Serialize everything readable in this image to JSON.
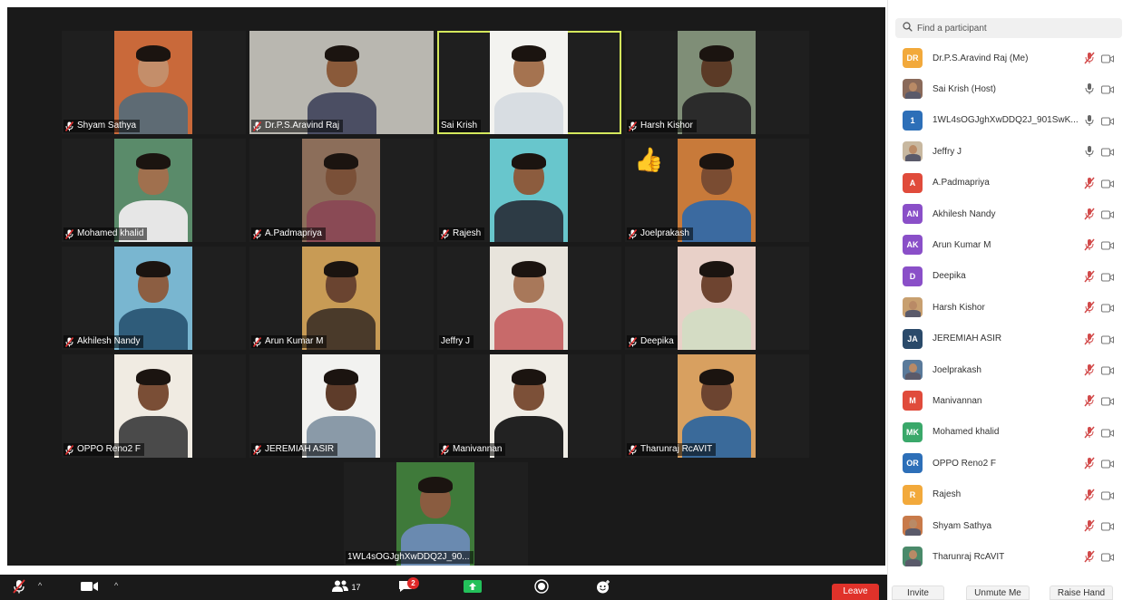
{
  "search": {
    "placeholder": "Find a participant"
  },
  "gallery": [
    {
      "name": "Shyam Sathya",
      "muted": true,
      "skin": "#c48e6a",
      "bg": "#c9693a",
      "shirt": "#5e6b74"
    },
    {
      "name": "Dr.P.S.Aravind Raj",
      "muted": true,
      "skin": "#8a5a3a",
      "bg": "#b9b7b0",
      "shirt": "#4b4e63"
    },
    {
      "name": "Sai Krish",
      "muted": false,
      "active": true,
      "skin": "#a57350",
      "bg": "#f3f3f0",
      "shirt": "#d8dde2"
    },
    {
      "name": "Harsh Kishor",
      "muted": true,
      "skin": "#5b3a26",
      "bg": "#7f8e77",
      "shirt": "#2b2b2b"
    },
    {
      "name": "Mohamed khalid",
      "muted": true,
      "skin": "#a0704e",
      "bg": "#5a8b6a",
      "shirt": "#e6e6e6"
    },
    {
      "name": "A.Padmapriya",
      "muted": true,
      "skin": "#7a5038",
      "bg": "#8c6e5a",
      "shirt": "#8a4a55"
    },
    {
      "name": "Rajesh",
      "muted": true,
      "skin": "#8c5c3e",
      "bg": "#68c6cc",
      "shirt": "#2d3b45"
    },
    {
      "name": "Joelprakash",
      "muted": true,
      "skin": "#7a4c32",
      "bg": "#c87a3a",
      "shirt": "#3b6aa0",
      "reaction": "👍"
    },
    {
      "name": "Akhilesh Nandy",
      "muted": true,
      "skin": "#8c5e42",
      "bg": "#79b6d0",
      "shirt": "#2f5c7a"
    },
    {
      "name": "Arun Kumar M",
      "muted": true,
      "skin": "#6a4430",
      "bg": "#c89b55",
      "shirt": "#4a3a2a"
    },
    {
      "name": "Jeffry J",
      "muted": false,
      "skin": "#a8785a",
      "bg": "#e8e4dc",
      "shirt": "#c86a6a"
    },
    {
      "name": "Deepika",
      "muted": true,
      "skin": "#6e4430",
      "bg": "#e8d0c8",
      "shirt": "#d4dcc4"
    },
    {
      "name": "OPPO Reno2 F",
      "muted": true,
      "skin": "#7a4e36",
      "bg": "#f0ebe2",
      "shirt": "#4a4a4a"
    },
    {
      "name": "JEREMIAH ASIR",
      "muted": true,
      "skin": "#5e3c2a",
      "bg": "#f2f2f0",
      "shirt": "#8a9aa8"
    },
    {
      "name": "Manivannan",
      "muted": true,
      "skin": "#7c5038",
      "bg": "#f0ede6",
      "shirt": "#222222"
    },
    {
      "name": "Tharunraj RcAVIT",
      "muted": true,
      "skin": "#6c4430",
      "bg": "#d8a060",
      "shirt": "#3a6a9a"
    },
    {
      "name": "1WL4sOGJghXwDDQ2J_90...",
      "muted": false,
      "skin": "#8a5c40",
      "bg": "#3f7a3a",
      "shirt": "#6a8ab0"
    }
  ],
  "toolbar": {
    "participants_count": "17",
    "chat_badge": "2",
    "leave_label": "Leave"
  },
  "participants": [
    {
      "name": "Dr.P.S.Aravind Raj (Me)",
      "initials": "DR",
      "color": "#f2a93b",
      "mic": "muted"
    },
    {
      "name": "Sai Krish (Host)",
      "photo": true,
      "color": "#8a6a5a",
      "mic": "on"
    },
    {
      "name": "1WL4sOGJghXwDDQ2J_901SwK...",
      "initials": "1",
      "color": "#2d6fb8",
      "mic": "on"
    },
    {
      "name": "Jeffry J",
      "photo": true,
      "color": "#c8b8a0",
      "mic": "on"
    },
    {
      "name": "A.Padmapriya",
      "initials": "A",
      "color": "#e04b3b",
      "mic": "muted"
    },
    {
      "name": "Akhilesh Nandy",
      "initials": "AN",
      "color": "#8a4fc8",
      "mic": "muted"
    },
    {
      "name": "Arun Kumar M",
      "initials": "AK",
      "color": "#8a4fc8",
      "mic": "muted"
    },
    {
      "name": "Deepika",
      "initials": "D",
      "color": "#8a4fc8",
      "mic": "muted"
    },
    {
      "name": "Harsh Kishor",
      "photo": true,
      "color": "#c8a070",
      "mic": "muted"
    },
    {
      "name": "JEREMIAH ASIR",
      "initials": "JA",
      "color": "#2a4a6a",
      "mic": "muted"
    },
    {
      "name": "Joelprakash",
      "photo": true,
      "color": "#5a7a9a",
      "mic": "muted"
    },
    {
      "name": "Manivannan",
      "initials": "M",
      "color": "#e04b3b",
      "mic": "muted"
    },
    {
      "name": "Mohamed khalid",
      "initials": "MK",
      "color": "#3aa86a",
      "mic": "muted"
    },
    {
      "name": "OPPO Reno2 F",
      "initials": "OR",
      "color": "#2d6fb8",
      "mic": "muted"
    },
    {
      "name": "Rajesh",
      "initials": "R",
      "color": "#f2a93b",
      "mic": "muted"
    },
    {
      "name": "Shyam Sathya",
      "photo": true,
      "color": "#c87a4a",
      "mic": "muted"
    },
    {
      "name": "Tharunraj RcAVIT",
      "photo": true,
      "color": "#4a8a6a",
      "mic": "muted"
    }
  ],
  "footer": {
    "invite_label": "Invite",
    "unmute_label": "Unmute Me",
    "raise_hand_label": "Raise Hand"
  }
}
